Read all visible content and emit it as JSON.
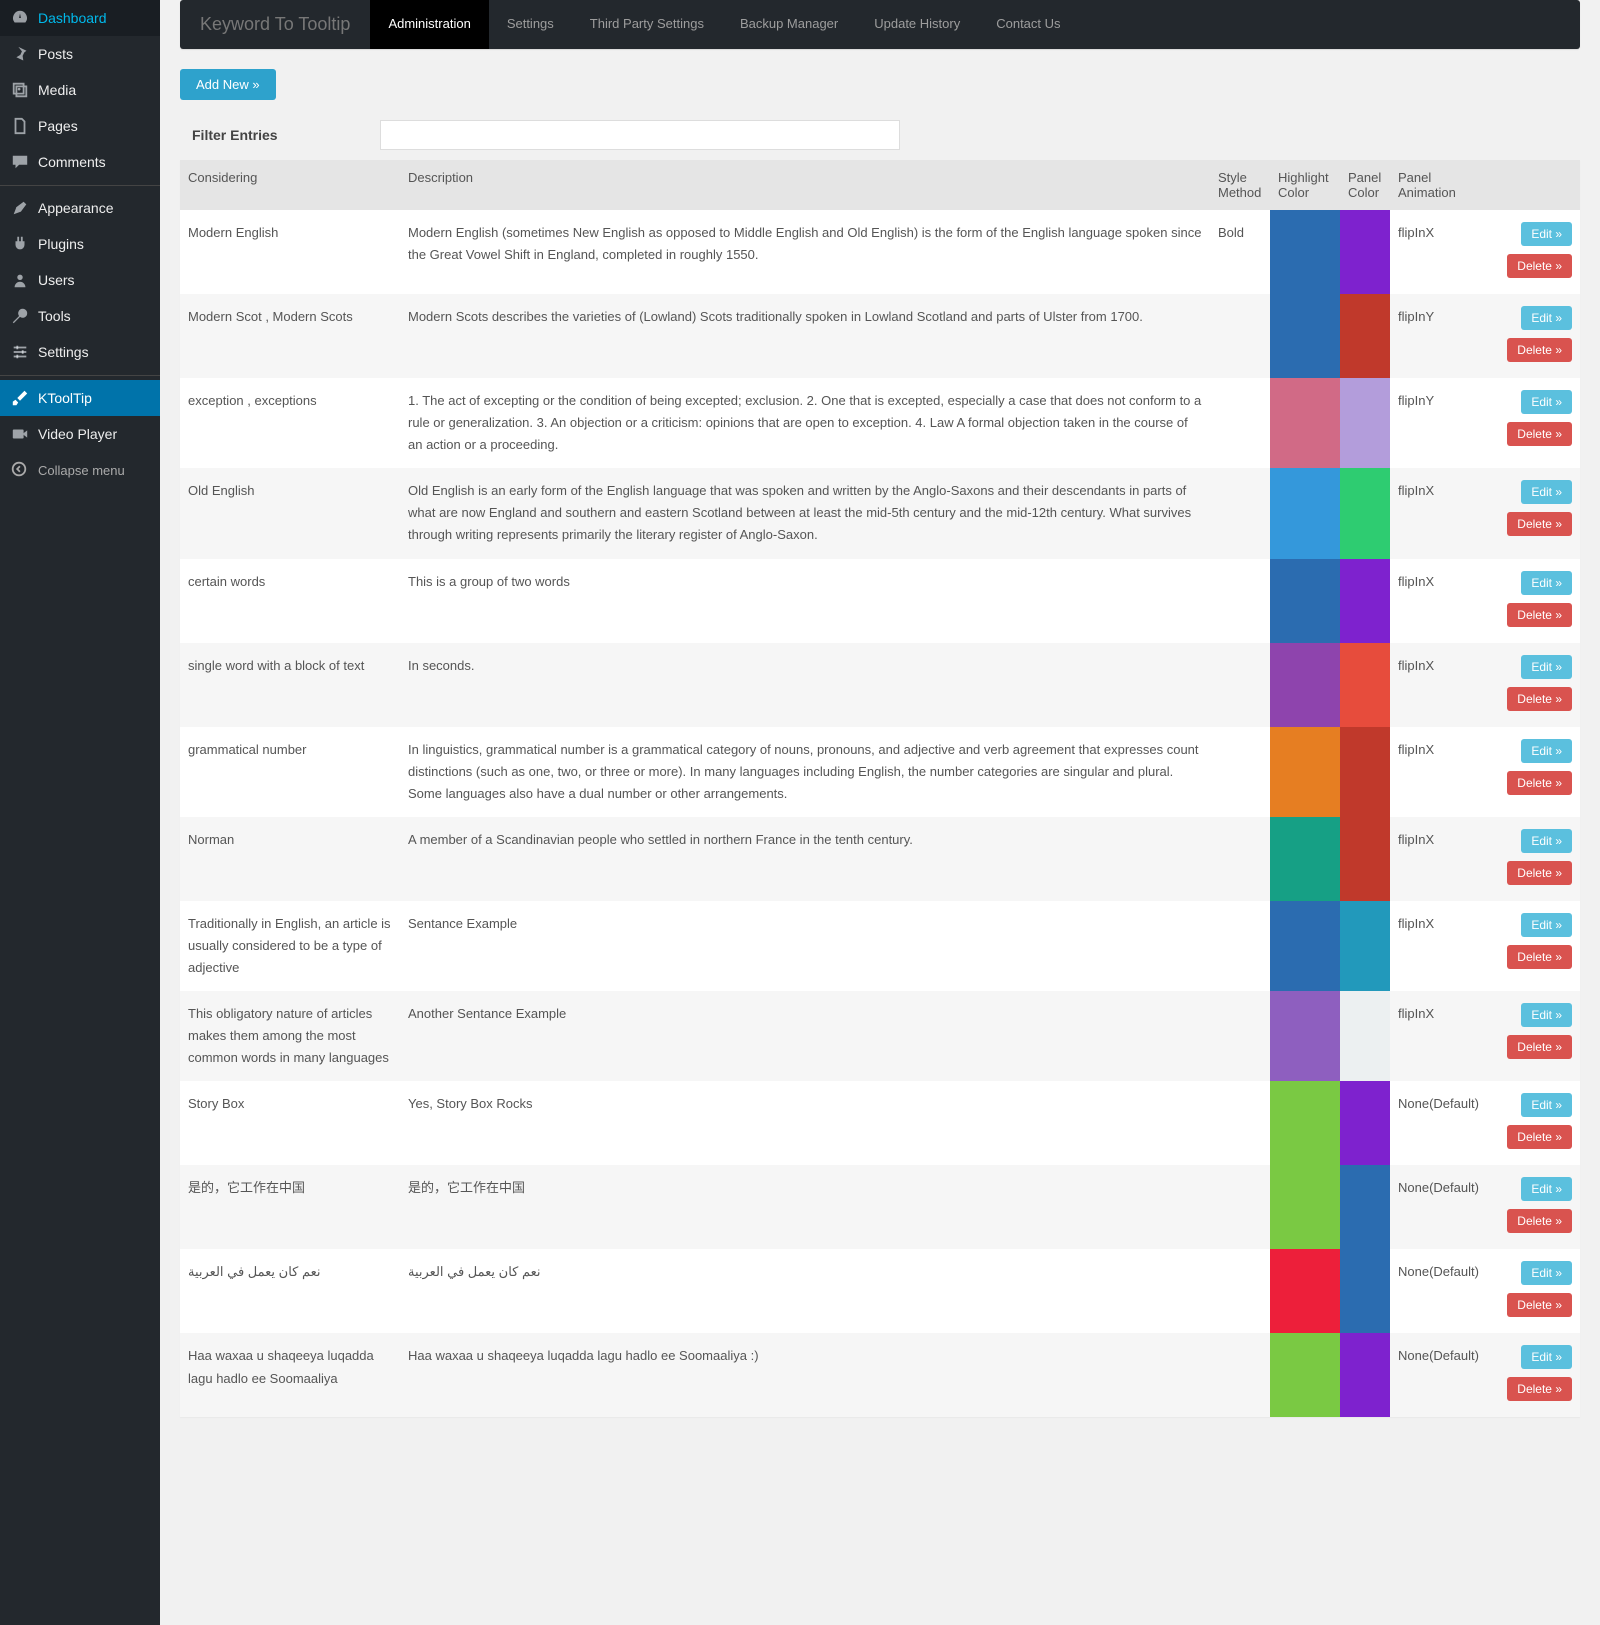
{
  "sidebar": {
    "items": [
      {
        "label": "Dashboard",
        "icon": "dashboard"
      },
      {
        "label": "Posts",
        "icon": "pin"
      },
      {
        "label": "Media",
        "icon": "media"
      },
      {
        "label": "Pages",
        "icon": "pages"
      },
      {
        "label": "Comments",
        "icon": "comments"
      },
      {
        "label": "Appearance",
        "icon": "appearance"
      },
      {
        "label": "Plugins",
        "icon": "plugins"
      },
      {
        "label": "Users",
        "icon": "users"
      },
      {
        "label": "Tools",
        "icon": "tools"
      },
      {
        "label": "Settings",
        "icon": "settings"
      },
      {
        "label": "KToolTip",
        "icon": "brush",
        "active": true
      },
      {
        "label": "Video Player",
        "icon": "video"
      }
    ],
    "collapse": "Collapse menu"
  },
  "topnav": {
    "brand": "Keyword To Tooltip",
    "items": [
      "Administration",
      "Settings",
      "Third Party Settings",
      "Backup Manager",
      "Update History",
      "Contact Us"
    ],
    "active": 0
  },
  "add_new": "Add New »",
  "filter": {
    "label": "Filter Entries",
    "value": ""
  },
  "table": {
    "headers": [
      "Considering",
      "Description",
      "Style Method",
      "Highlight Color",
      "Panel Color",
      "Panel Animation"
    ],
    "edit": "Edit »",
    "delete": "Delete »",
    "rows": [
      {
        "considering": "Modern English",
        "description": "Modern English (sometimes New English as opposed to Middle English and Old English) is the form of the English language spoken since the Great Vowel Shift in England, completed in roughly 1550.",
        "style": "Bold",
        "hcolor": "#2b6cb0",
        "pcolor": "#7e22ce",
        "anim": "flipInX"
      },
      {
        "considering": "Modern Scot , Modern Scots",
        "description": "Modern Scots describes the varieties of (Lowland) Scots traditionally spoken in Lowland Scotland and parts of Ulster from 1700.",
        "style": "",
        "hcolor": "#2b6cb0",
        "pcolor": "#c0392b",
        "anim": "flipInY"
      },
      {
        "considering": "exception , exceptions",
        "description": "1. The act of excepting or the condition of being excepted; exclusion. 2. One that is excepted, especially a case that does not conform to a rule or generalization. 3. An objection or a criticism: opinions that are open to exception. 4. Law A formal objection taken in the course of an action or a proceeding.",
        "style": "",
        "hcolor": "#d16a86",
        "pcolor": "#b39ddb",
        "anim": "flipInY"
      },
      {
        "considering": "Old English",
        "description": "Old English is an early form of the English language that was spoken and written by the Anglo-Saxons and their descendants in parts of what are now England and southern and eastern Scotland between at least the mid-5th century and the mid-12th century. What survives through writing represents primarily the literary register of Anglo-Saxon.",
        "style": "",
        "hcolor": "#3498db",
        "pcolor": "#2ecc71",
        "anim": "flipInX"
      },
      {
        "considering": "certain words",
        "description": "This is a group of two words",
        "style": "",
        "hcolor": "#2b6cb0",
        "pcolor": "#7e22ce",
        "anim": "flipInX"
      },
      {
        "considering": "single word with a block of text",
        "description": "In seconds.",
        "style": "",
        "hcolor": "#8e44ad",
        "pcolor": "#e74c3c",
        "anim": "flipInX"
      },
      {
        "considering": "grammatical number",
        "description": "In linguistics, grammatical number is a grammatical category of nouns, pronouns, and adjective and verb agreement that expresses count distinctions (such as one, two, or three or more). In many languages including English, the number categories are singular and plural. Some languages also have a dual number or other arrangements.",
        "style": "",
        "hcolor": "#e67e22",
        "pcolor": "#c0392b",
        "anim": "flipInX"
      },
      {
        "considering": "Norman",
        "description": "A member of a Scandinavian people who settled in northern France in the tenth century.",
        "style": "",
        "hcolor": "#16a085",
        "pcolor": "#c0392b",
        "anim": "flipInX"
      },
      {
        "considering": "Traditionally in English, an article is usually considered to be a type of adjective",
        "description": "Sentance Example",
        "style": "",
        "hcolor": "#2b6cb0",
        "pcolor": "#2299bb",
        "anim": "flipInX"
      },
      {
        "considering": "This obligatory nature of articles makes them among the most common words in many languages",
        "description": "Another Sentance Example",
        "style": "",
        "hcolor": "#8e5fbf",
        "pcolor": "#ecf0f1",
        "anim": "flipInX"
      },
      {
        "considering": "Story Box",
        "description": "Yes, Story Box Rocks",
        "style": "",
        "hcolor": "#7ac943",
        "pcolor": "#7e22ce",
        "anim": "None(Default)"
      },
      {
        "considering": "是的，它工作在中国",
        "description": "是的，它工作在中国",
        "style": "",
        "hcolor": "#7ac943",
        "pcolor": "#2b6cb0",
        "anim": "None(Default)"
      },
      {
        "considering": "نعم كان يعمل في العربية",
        "description": "نعم كان يعمل في العربية",
        "style": "",
        "hcolor": "#ed1f3a",
        "pcolor": "#2b6cb0",
        "anim": "None(Default)"
      },
      {
        "considering": "Haa waxaa u shaqeeya luqadda lagu hadlo ee Soomaaliya",
        "description": "Haa waxaa u shaqeeya luqadda lagu hadlo ee Soomaaliya :)",
        "style": "",
        "hcolor": "#7ac943",
        "pcolor": "#7e22ce",
        "anim": "None(Default)"
      }
    ]
  }
}
